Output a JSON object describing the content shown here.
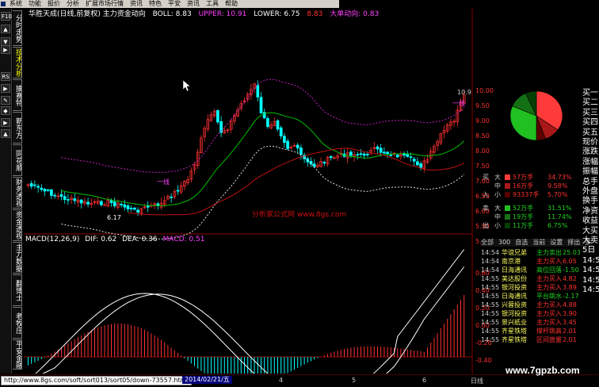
{
  "menu": {
    "items": [
      "系统",
      "功能",
      "报价",
      "分析",
      "扩展市场行情",
      "资讯",
      "特色",
      "平安",
      "资讯",
      "工具",
      "帮助"
    ]
  },
  "left_tools": [
    "F10",
    "▲",
    "▼",
    "▶",
    "RS",
    "▶",
    "✎",
    "◆",
    "▶",
    "▲"
  ],
  "left_vtabs": [
    {
      "label": "分时走势",
      "active": false
    },
    {
      "label": "技术分析",
      "active": true
    },
    {
      "label": "擒赛特",
      "active": false
    },
    {
      "label": "新东方",
      "active": false
    },
    {
      "label": "同花顺",
      "active": false
    },
    {
      "label": "财务透视",
      "active": false
    },
    {
      "label": "资金透视",
      "active": false
    },
    {
      "label": "主力数据",
      "active": false
    },
    {
      "label": "翻博士",
      "active": false
    },
    {
      "label": "老牧庄",
      "active": false
    },
    {
      "label": "平安金融",
      "active": false
    }
  ],
  "info": {
    "stock": "华胜天成(日线,前复权) 主力资金动向",
    "boll": "BOLL: 8.83",
    "upper": "UPPER: 10.91",
    "lower": "LOWER: 6.75",
    "mid": "8.83",
    "extra": "大单动向: 0.83"
  },
  "annotations": {
    "high": "10.9",
    "low": "6.17",
    "buy1": "一线",
    "buy2": "一线"
  },
  "price_axis": [
    "10.00",
    "9.50",
    "9.00",
    "8.50",
    "8.00",
    "7.50",
    "7.00",
    "6.50",
    "6.00",
    "5.50",
    "5.00"
  ],
  "macd": {
    "name": "MACD(12,26,9)",
    "dif": "DIF: 0.62",
    "dea": "DEA: 0.36",
    "macd": "MACD: 0.51",
    "axis": [
      "0.60",
      "0.40",
      "0.20",
      "0.00",
      "-0.20",
      "-0.40"
    ]
  },
  "order_book": [
    {
      "side": "买",
      "lvl": "大",
      "vol": "57万手",
      "pct": "34.73%",
      "color": "#ff3a3a"
    },
    {
      "side": "",
      "lvl": "中",
      "vol": "16万手",
      "pct": "9.58%",
      "color": "#a81818"
    },
    {
      "side": "入",
      "lvl": "小",
      "vol": "93337手",
      "pct": "5.70%",
      "color": "#5a0000"
    },
    {
      "side": "卖",
      "lvl": "大",
      "vol": "52万手",
      "pct": "31.51%",
      "color": "#20c020"
    },
    {
      "side": "",
      "lvl": "中",
      "vol": "19万手",
      "pct": "11.74%",
      "color": "#147014"
    },
    {
      "side": "出",
      "lvl": "小",
      "vol": "11万手",
      "pct": "6.75%",
      "color": "#064006"
    }
  ],
  "pie": {
    "slices": [
      {
        "value": 34.73,
        "color": "#ff3a3a"
      },
      {
        "value": 9.58,
        "color": "#a81818"
      },
      {
        "value": 5.7,
        "color": "#5a0000"
      },
      {
        "value": 31.51,
        "color": "#20c020"
      },
      {
        "value": 11.74,
        "color": "#147014"
      },
      {
        "value": 6.75,
        "color": "#064006"
      }
    ]
  },
  "ob_tabs": [
    "全部",
    "300",
    "自选",
    "当前",
    "设置",
    "择出",
    "多"
  ],
  "ticks": [
    {
      "time": "14:54",
      "name": "华谊兄弟",
      "action": "主力卖出",
      "value": "25.03",
      "color": "#20d020"
    },
    {
      "time": "14:54",
      "name": "南京港",
      "action": "主力买入",
      "value": "6.05",
      "color": "#ff3030"
    },
    {
      "time": "14:54",
      "name": "日海通讯",
      "action": "高位回落",
      "value": "-1.50",
      "color": "#20d020"
    },
    {
      "time": "14:55",
      "name": "美达股份",
      "action": "主力买入",
      "value": "4.82",
      "color": "#ff3030"
    },
    {
      "time": "14:55",
      "name": "银河投资",
      "action": "主力买入",
      "value": "3.89",
      "color": "#ff3030"
    },
    {
      "time": "14:55",
      "name": "日海通讯",
      "action": "平台跳水",
      "value": "-2.17",
      "color": "#20d020"
    },
    {
      "time": "14:55",
      "name": "兴蓉投资",
      "action": "主力买入",
      "value": "4.88",
      "color": "#ff3030"
    },
    {
      "time": "14:55",
      "name": "银河投资",
      "action": "主力买入",
      "value": "3.90",
      "color": "#ff3030"
    },
    {
      "time": "14:55",
      "name": "景兴纸业",
      "action": "主力买入",
      "value": "3.45",
      "color": "#ff3030"
    },
    {
      "time": "14:55",
      "name": "齐星铁塔",
      "action": "撑杆跳高",
      "value": "2.01",
      "color": "#ff3030"
    },
    {
      "time": "14:55",
      "name": "齐星铁塔",
      "action": "区间放量",
      "value": "2.01",
      "color": "#ff3030"
    }
  ],
  "side_col": [
    "买一",
    "买二",
    "买三",
    "买四",
    "买五",
    "现价",
    "涨跌",
    "涨幅",
    "振幅",
    "总手",
    "外盘",
    "换手",
    "净资",
    "收益",
    "大买",
    "大卖",
    "5日",
    "14:5",
    "14:5",
    "14:5",
    "14:5"
  ],
  "status": {
    "url": "http://www.8gs.com/soft/sort013/sort05/down-73557.html",
    "date": "2014/02/21/五",
    "months": [
      "4",
      "5",
      "6"
    ],
    "corner": "日线"
  },
  "watermarks": {
    "bottom": "www.7gpzb.com",
    "middle": "分析家公式网 www.8gs.com"
  },
  "colors": {
    "up": "#ff3030",
    "down": "#00ffff",
    "mid_line": "#00c000",
    "upper_line": "#c020c0",
    "lower_line": "#e0e0e0",
    "ma_red": "#c01010"
  }
}
